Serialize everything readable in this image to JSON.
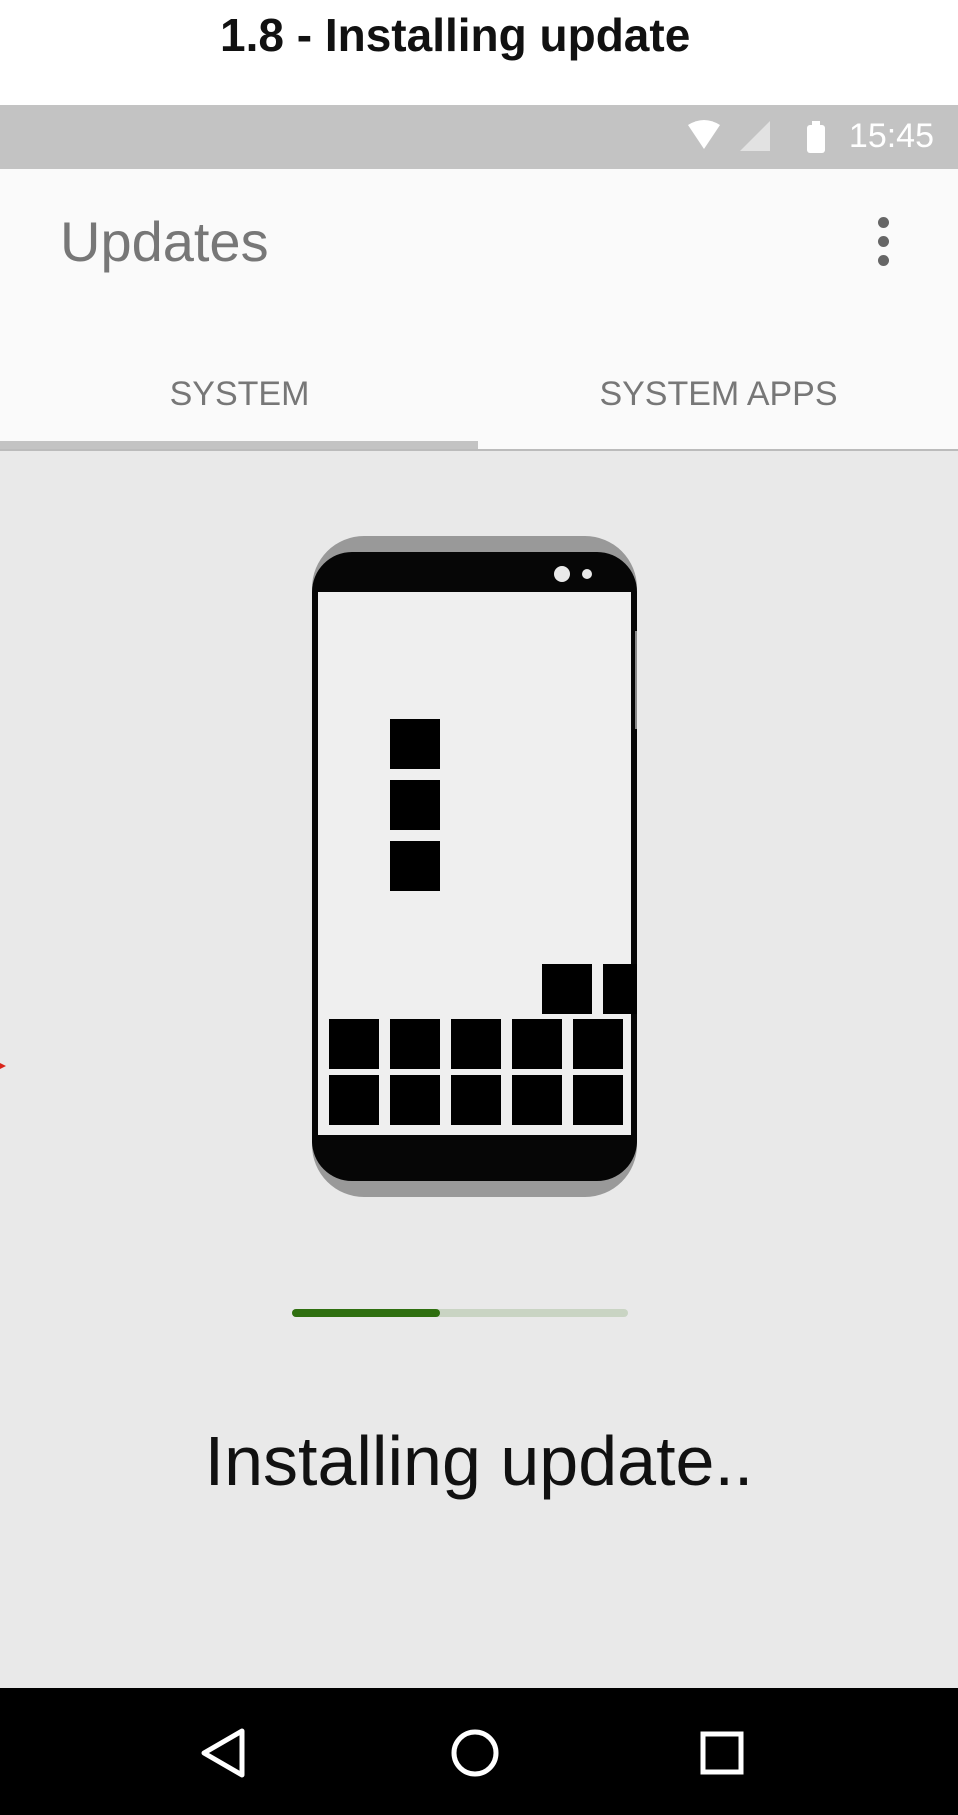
{
  "caption": {
    "title": "1.8 - Installing update"
  },
  "status_bar": {
    "time": "15:45",
    "icons": [
      "wifi-icon",
      "cell-signal-icon",
      "battery-icon"
    ]
  },
  "app_bar": {
    "title": "Updates",
    "overflow_icon": "more-vert-icon"
  },
  "tabs": [
    {
      "label": "SYSTEM",
      "selected": true
    },
    {
      "label": "SYSTEM APPS",
      "selected": false
    }
  ],
  "content": {
    "illustration": "phone-with-falling-blocks",
    "progress_fraction": 0.44,
    "message": "Installing update.."
  },
  "nav_bar": {
    "buttons": [
      "back-icon",
      "home-icon",
      "recents-icon"
    ]
  },
  "colors": {
    "status_bar": "#c3c3c3",
    "app_bar": "#fafafa",
    "content_bg": "#e9e9e9",
    "progress_fill": "#2f6f10",
    "progress_track": "#c9d4c3",
    "nav_bar": "#000000"
  }
}
